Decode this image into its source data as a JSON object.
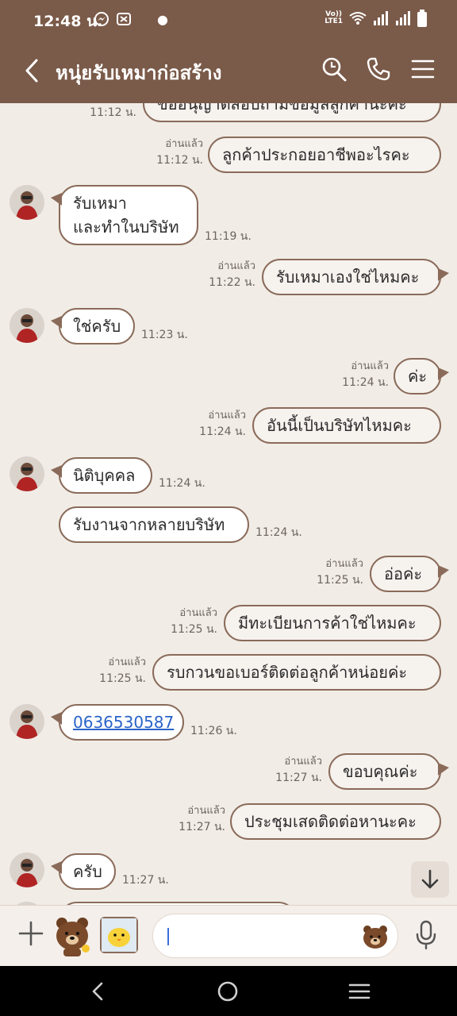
{
  "status": {
    "time": "12:48 น.",
    "volte_top": "Vo))",
    "volte_bottom": "LTE1"
  },
  "header": {
    "title": "หนุ่ยรับเหมาก่อสร้าง"
  },
  "messages": {
    "m0": {
      "text": "ขออนุญาตสอบถามข้อมูลลูกค้านะคะ",
      "time": "11:12 น."
    },
    "m1": {
      "text": "ลูกค้าประกอยอาชีพอะไรคะ",
      "time": "11:12 น.",
      "read": "อ่านแล้ว"
    },
    "m2": {
      "line1": "รับเหมา",
      "line2": "และทำในบริษัท",
      "time": "11:19 น."
    },
    "m3": {
      "text": "รับเหมาเองใช่ไหมคะ",
      "time": "11:22 น.",
      "read": "อ่านแล้ว"
    },
    "m4": {
      "text": "ใช่ครับ",
      "time": "11:23 น."
    },
    "m5": {
      "text": "ค่ะ",
      "time": "11:24 น.",
      "read": "อ่านแล้ว"
    },
    "m6": {
      "text": "อันนี้เป็นบริษัทไหมคะ",
      "time": "11:24 น.",
      "read": "อ่านแล้ว"
    },
    "m7": {
      "text": "นิติบุคคล",
      "time": "11:24 น."
    },
    "m8": {
      "text": "รับงานจากหลายบริษัท",
      "time": "11:24 น."
    },
    "m9": {
      "text": "อ่อค่ะ",
      "time": "11:25 น.",
      "read": "อ่านแล้ว"
    },
    "m10": {
      "text": "มีทะเบียนการค้าใช่ไหมคะ",
      "time": "11:25 น.",
      "read": "อ่านแล้ว"
    },
    "m11": {
      "text": "รบกวนขอเบอร์ติดต่อลูกค้าหน่อยค่ะ",
      "time": "11:25 น.",
      "read": "อ่านแล้ว"
    },
    "m12": {
      "text": "0636530587",
      "time": "11:26 น."
    },
    "m13": {
      "text": "ขอบคุณค่ะ",
      "time": "11:27 น.",
      "read": "อ่านแล้ว"
    },
    "m14": {
      "text": "ประชุมเสดติดต่อหานะคะ",
      "time": "11:27 น.",
      "read": "อ่านแล้ว"
    },
    "m15": {
      "text": "ครับ",
      "time": "11:27 น."
    }
  },
  "input": {
    "value": "",
    "placeholder": ""
  },
  "icons": {
    "back": "chevron-left-icon",
    "search": "search-icon",
    "call": "phone-icon",
    "menu": "menu-icon",
    "add": "plus-icon",
    "sticker1": "brown-bear-sticker",
    "sticker2": "sally-chick-sticker",
    "emoji": "bear-face-icon",
    "mic": "microphone-icon",
    "scroll": "arrow-down-icon"
  },
  "colors": {
    "header": "#7a5a49",
    "background": "#f1ece6",
    "bubble_border": "#8a6b5a",
    "link": "#2a63c8"
  }
}
